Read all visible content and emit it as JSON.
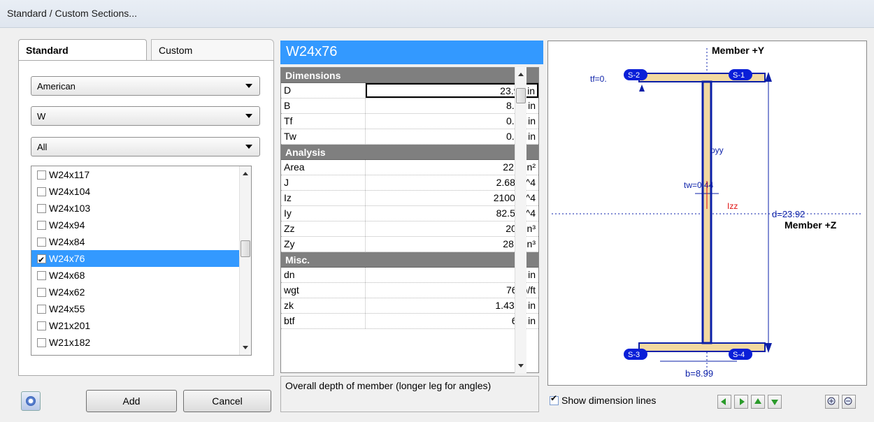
{
  "window": {
    "title": "Standard / Custom Sections..."
  },
  "tabs": {
    "standard": "Standard",
    "custom": "Custom"
  },
  "filters": {
    "region": "American",
    "shape": "W",
    "group": "All"
  },
  "sections_list": [
    {
      "label": "W24x117",
      "checked": false,
      "selected": false
    },
    {
      "label": "W24x104",
      "checked": false,
      "selected": false
    },
    {
      "label": "W24x103",
      "checked": false,
      "selected": false
    },
    {
      "label": "W24x94",
      "checked": false,
      "selected": false
    },
    {
      "label": "W24x84",
      "checked": false,
      "selected": false
    },
    {
      "label": "W24x76",
      "checked": true,
      "selected": true
    },
    {
      "label": "W24x68",
      "checked": false,
      "selected": false
    },
    {
      "label": "W24x62",
      "checked": false,
      "selected": false
    },
    {
      "label": "W24x55",
      "checked": false,
      "selected": false
    },
    {
      "label": "W21x201",
      "checked": false,
      "selected": false
    },
    {
      "label": "W21x182",
      "checked": false,
      "selected": false
    }
  ],
  "buttons": {
    "add": "Add",
    "cancel": "Cancel"
  },
  "selected_name": "W24x76",
  "property_grid": {
    "dimensions_header": "Dimensions",
    "dimensions": [
      {
        "key": "D",
        "value": "23.92 in"
      },
      {
        "key": "B",
        "value": "8.99 in"
      },
      {
        "key": "Tf",
        "value": "0.68 in"
      },
      {
        "key": "Tw",
        "value": "0.44 in"
      }
    ],
    "analysis_header": "Analysis",
    "analysis": [
      {
        "key": "Area",
        "value": "22.4 in²"
      },
      {
        "key": "J",
        "value": "2.68 in^4"
      },
      {
        "key": "Iz",
        "value": "2100 in^4"
      },
      {
        "key": "Iy",
        "value": "82.5 in^4"
      },
      {
        "key": "Zz",
        "value": "200 in³"
      },
      {
        "key": "Zy",
        "value": "28.6 in³"
      }
    ],
    "misc_header": "Misc.",
    "misc": [
      {
        "key": "dn",
        "value": "24 in"
      },
      {
        "key": "wgt",
        "value": "76 lb/ft"
      },
      {
        "key": "zk",
        "value": "1.4375 in"
      },
      {
        "key": "btf",
        "value": "6.6 in"
      }
    ]
  },
  "description": "Overall depth of member (longer leg for angles)",
  "diagram": {
    "member_y": "Member +Y",
    "member_z": "Member +Z",
    "tf_label": "tf=0.",
    "tw_label": "tw=0.44",
    "d_label": "d=23.92",
    "b_label": "b=8.99",
    "pyy": "pyy",
    "izz": "Izz",
    "s1": "S-1",
    "s2": "S-2",
    "s3": "S-3",
    "s4": "S-4",
    "colors": {
      "flange": "#f2d9a0",
      "web": "#0a1fa8",
      "badge": "#0a1fd8",
      "izz": "#e01010"
    }
  },
  "show_dimension_lines": {
    "label": "Show dimension lines",
    "checked": true
  }
}
